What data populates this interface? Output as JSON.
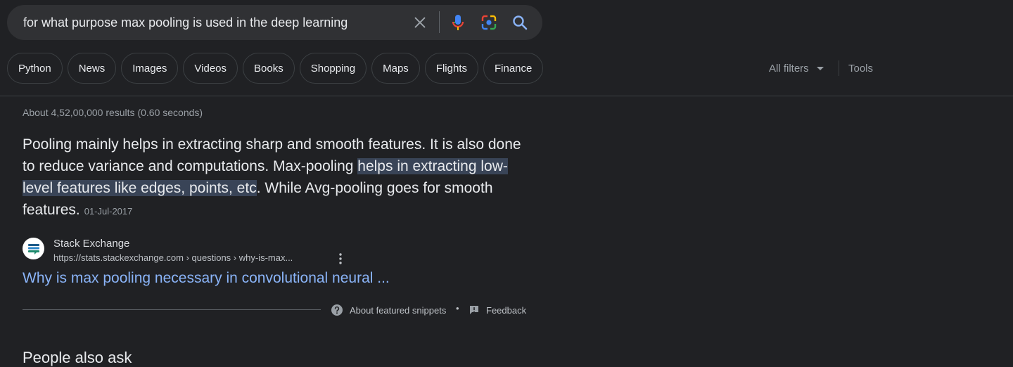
{
  "search": {
    "query": "for what purpose max pooling is used in the deep learning"
  },
  "chips": [
    "Python",
    "News",
    "Images",
    "Videos",
    "Books",
    "Shopping",
    "Maps",
    "Flights",
    "Finance"
  ],
  "filters": {
    "all_filters": "All filters",
    "tools": "Tools"
  },
  "stats": "About 4,52,00,000 results (0.60 seconds)",
  "snippet": {
    "text_before": "Pooling mainly helps in extracting sharp and smooth features. It is also done to reduce variance and computations. Max-pooling ",
    "highlight": "helps in extracting low-level features like edges, points, etc",
    "text_after": ". While Avg-pooling goes for smooth features.",
    "date": "01-Jul-2017"
  },
  "source": {
    "name": "Stack Exchange",
    "url": "https://stats.stackexchange.com › questions › why-is-max...",
    "title": "Why is max pooling necessary in convolutional neural ..."
  },
  "footer": {
    "about": "About featured snippets",
    "separator": "•",
    "feedback": "Feedback"
  },
  "next_section": {
    "heading": "People also ask"
  },
  "icons": {
    "clear": "close-icon",
    "voice": "microphone-icon",
    "lens": "google-lens-icon",
    "search": "search-icon"
  },
  "colors": {
    "background": "#202124",
    "link": "#8ab4f8",
    "highlight": "#394457"
  }
}
